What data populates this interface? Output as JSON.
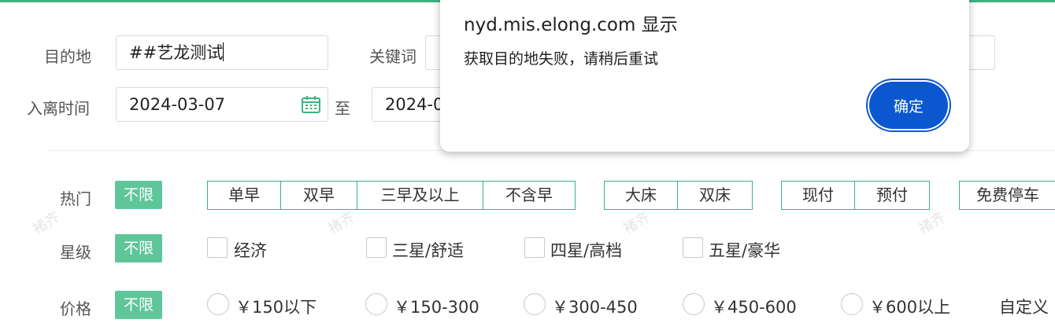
{
  "colors": {
    "accent": "#3fb27f",
    "tag_bg": "#5fc69a",
    "dialog_button": "#0b57d0"
  },
  "form": {
    "destination_label": "目的地",
    "destination_value": "##艺龙测试",
    "keyword_label": "关键词",
    "dates_label": "入离时间",
    "checkin_value": "2024-03-07",
    "date_separator": "至",
    "checkout_value_visible": "2024-0"
  },
  "filters": {
    "hot": {
      "label": "热门",
      "unlimited": "不限",
      "groups": [
        [
          "单早",
          "双早",
          "三早及以上",
          "不含早"
        ],
        [
          "大床",
          "双床"
        ],
        [
          "现付",
          "预付"
        ],
        [
          "免费停车"
        ]
      ]
    },
    "star": {
      "label": "星级",
      "unlimited": "不限",
      "options": [
        "经济",
        "三星/舒适",
        "四星/高档",
        "五星/豪华"
      ]
    },
    "price": {
      "label": "价格",
      "unlimited": "不限",
      "options": [
        "￥150以下",
        "￥150-300",
        "￥300-450",
        "￥450-600",
        "￥600以上"
      ],
      "custom": "自定义"
    }
  },
  "watermark": "褚齐",
  "dialog": {
    "title": "nyd.mis.elong.com 显示",
    "message": "获取目的地失败，请稍后重试",
    "ok_label": "确定"
  },
  "icons": {
    "calendar": "calendar-icon"
  }
}
